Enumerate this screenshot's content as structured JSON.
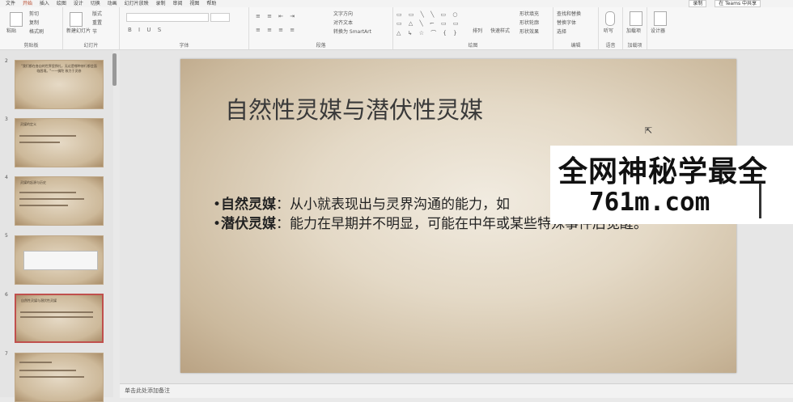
{
  "menu": {
    "items": [
      "文件",
      "开始",
      "插入",
      "绘图",
      "设计",
      "切换",
      "动画",
      "幻灯片放映",
      "录制",
      "审阅",
      "视图",
      "帮助"
    ],
    "active_index": 1,
    "top_right": [
      "录制",
      "在 Teams 中共享"
    ]
  },
  "ribbon": {
    "clipboard": {
      "paste": "粘贴",
      "cut": "剪切",
      "copy": "复制",
      "format_painter": "格式刷",
      "label": "剪贴板"
    },
    "slides": {
      "new_slide": "新建幻灯片",
      "layout": "版式",
      "reset": "重置",
      "section": "节",
      "label": "幻灯片"
    },
    "font": {
      "label": "字体",
      "bold": "B",
      "italic": "I",
      "underline": "U",
      "strike": "S"
    },
    "paragraph": {
      "label": "段落",
      "text_direction": "文字方向",
      "align_text": "对齐文本",
      "smartart": "转换为 SmartArt"
    },
    "drawing": {
      "label": "绘图",
      "arrange": "排列",
      "quick_styles": "快速样式",
      "shape_fill": "形状填充",
      "shape_outline": "形状轮廓",
      "shape_effects": "形状效果"
    },
    "editing": {
      "label": "编辑",
      "find": "查找和替换",
      "replace": "替换字体",
      "select": "选择"
    },
    "voice": {
      "label": "语音",
      "dictate": "听写"
    },
    "addins": {
      "label": "加载项",
      "item": "加载项"
    },
    "designer": {
      "label": "设计器"
    }
  },
  "thumbnails": [
    {
      "num": "2",
      "text": "\"我们都在各自的世界里挣扎，无论是哪种修行都会面临困境。\"——佛陀 致力于灵修"
    },
    {
      "num": "3",
      "text": "灵媒的定义"
    },
    {
      "num": "4",
      "text": "灵媒的起源与历史"
    },
    {
      "num": "5",
      "text": ""
    },
    {
      "num": "6",
      "text": "自然性灵媒与潜伏性灵媒",
      "selected": true
    },
    {
      "num": "7",
      "text": ""
    }
  ],
  "slide": {
    "title": "自然性灵媒与潜伏性灵媒",
    "bullets": [
      {
        "term": "自然灵媒",
        "text": "：从小就表现出与灵界沟通的能力，如"
      },
      {
        "term": "潜伏灵媒",
        "text": "：能力在早期并不明显，可能在中年或某些特殊事件后觉醒。"
      }
    ]
  },
  "watermark": {
    "line1": "全网神秘学最全",
    "line2": "761m.com"
  },
  "notes": {
    "placeholder": "单击此处添加备注"
  },
  "colors": {
    "accent": "#b7472a",
    "selected_border": "#c0504d",
    "slide_bg": "#e4d9c6"
  }
}
